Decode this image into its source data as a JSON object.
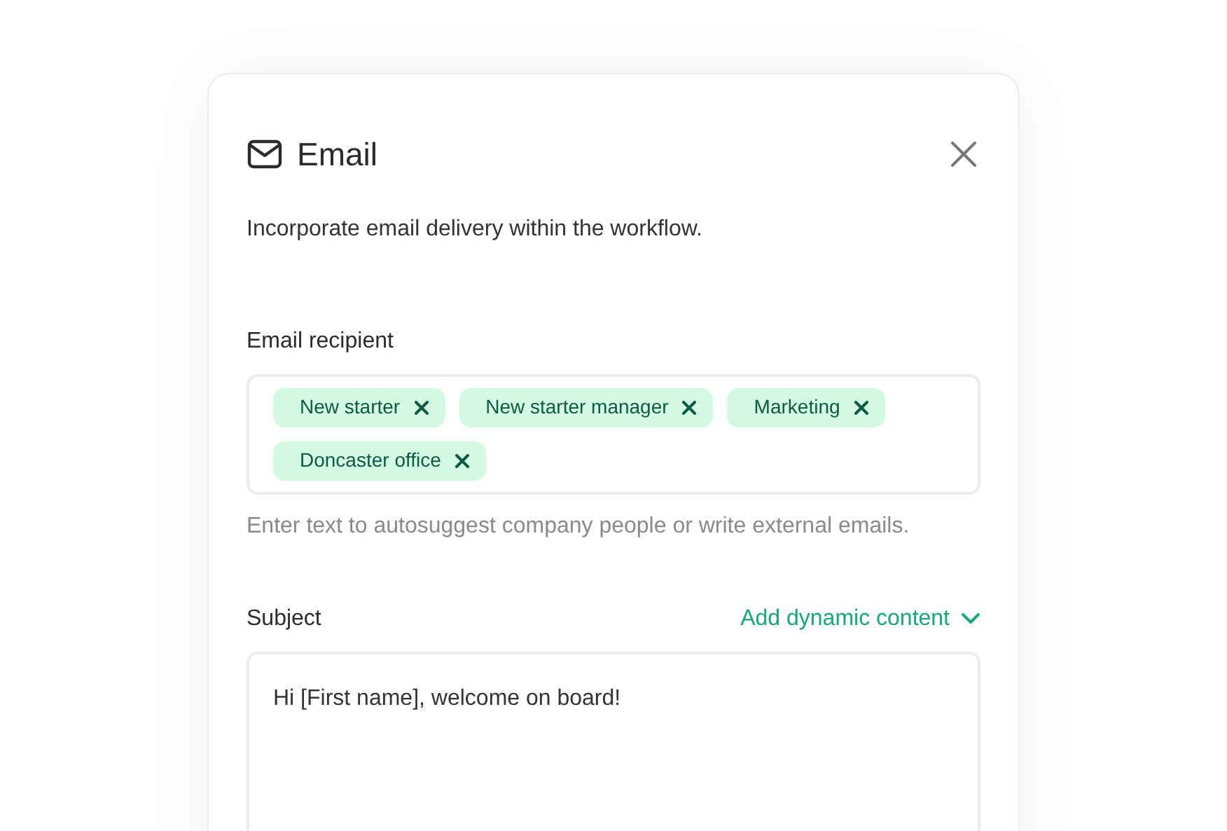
{
  "dialog": {
    "title": "Email",
    "description": "Incorporate email delivery within the workflow."
  },
  "recipients": {
    "label": "Email recipient",
    "chips": [
      {
        "label": "New starter"
      },
      {
        "label": "New starter manager"
      },
      {
        "label": "Marketing"
      },
      {
        "label": "Doncaster office"
      }
    ],
    "help": "Enter text to autosuggest company people or write external emails."
  },
  "subject": {
    "label": "Subject",
    "dynamic_link": "Add dynamic content",
    "value": "Hi [First name], welcome on board!"
  }
}
